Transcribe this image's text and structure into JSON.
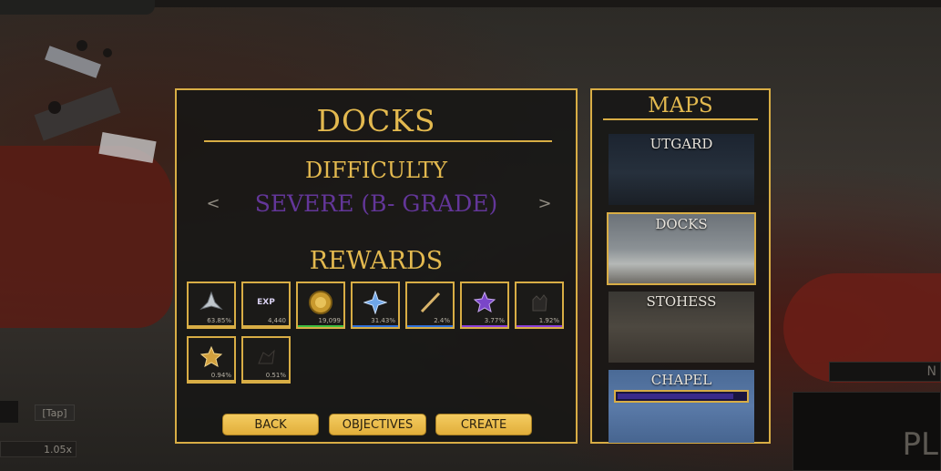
{
  "background": {
    "tap_label": "[Tap]",
    "speed_value": "1.05x",
    "name_plate": "N",
    "play_label": "PL"
  },
  "panel": {
    "title": "DOCKS",
    "difficulty_label": "DIFFICULTY",
    "difficulty_value": "SEVERE (B- GRADE)",
    "prev_arrow": "<",
    "next_arrow": ">",
    "rewards_label": "REWARDS",
    "rewards": [
      {
        "icon": "silver-crest-icon",
        "pct": "63.85%",
        "rarity_color": "#d8ad45"
      },
      {
        "icon": "exp-icon",
        "label": "EXP",
        "pct": "4,440",
        "rarity_color": "#d8ad45"
      },
      {
        "icon": "gold-coin-icon",
        "pct": "19,099",
        "rarity_color": "#3fbf3f"
      },
      {
        "icon": "blue-crystal-icon",
        "pct": "31.43%",
        "rarity_color": "#2f6fd8"
      },
      {
        "icon": "blade-icon",
        "pct": "2.4%",
        "rarity_color": "#2f6fd8"
      },
      {
        "icon": "purple-emblem-icon",
        "pct": "3.77%",
        "rarity_color": "#8a3fd8"
      },
      {
        "icon": "dark-glove-icon",
        "pct": "1.92%",
        "rarity_color": "#8a3fd8"
      },
      {
        "icon": "gold-emblem-icon",
        "pct": "0.94%",
        "rarity_color": "#d8ad45"
      },
      {
        "icon": "dark-shard-icon",
        "pct": "0.51%",
        "rarity_color": "#d8ad45"
      }
    ],
    "buttons": {
      "back": "BACK",
      "objectives": "OBJECTIVES",
      "create": "CREATE"
    }
  },
  "maps": {
    "title": "MAPS",
    "items": [
      {
        "name": "UTGARD"
      },
      {
        "name": "DOCKS",
        "selected": true
      },
      {
        "name": "STOHESS"
      },
      {
        "name": "CHAPEL",
        "locked_progress": 0.88
      }
    ]
  }
}
